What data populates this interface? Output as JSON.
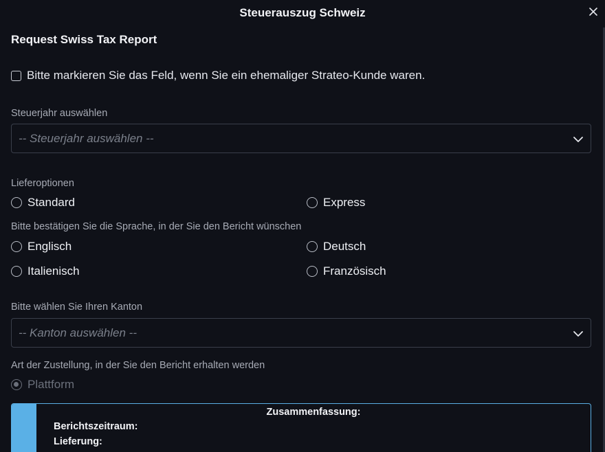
{
  "dialog": {
    "title": "Steuerauszug Schweiz",
    "close_icon": "close-icon"
  },
  "form": {
    "heading": "Request Swiss Tax Report",
    "former_client_checkbox": {
      "label": "Bitte markieren Sie das Feld, wenn Sie ein ehemaliger Strateo-Kunde waren.",
      "checked": false
    },
    "tax_year": {
      "label": "Steuerjahr auswählen",
      "placeholder": "-- Steuerjahr auswählen --"
    },
    "delivery_options": {
      "label": "Lieferoptionen",
      "options": [
        "Standard",
        "Express"
      ]
    },
    "language": {
      "label": "Bitte bestätigen Sie die Sprache, in der Sie den Bericht wünschen",
      "options": [
        "Englisch",
        "Deutsch",
        "Italienisch",
        "Französisch"
      ]
    },
    "canton": {
      "label": "Bitte wählen Sie Ihren Kanton",
      "placeholder": "-- Kanton auswählen --"
    },
    "delivery_type": {
      "label": "Art der Zustellung, in der Sie den Bericht erhalten werden",
      "options": [
        "Plattform"
      ],
      "selected": "Plattform",
      "disabled": true
    }
  },
  "summary": {
    "title": "Zusammenfassung:",
    "report_period_label": "Berichtszeitraum:",
    "delivery_label": "Lieferung:"
  },
  "colors": {
    "background": "#0f1118",
    "accent": "#5ab0e6",
    "border": "#3a3f4b",
    "muted_text": "#a7abb5"
  }
}
